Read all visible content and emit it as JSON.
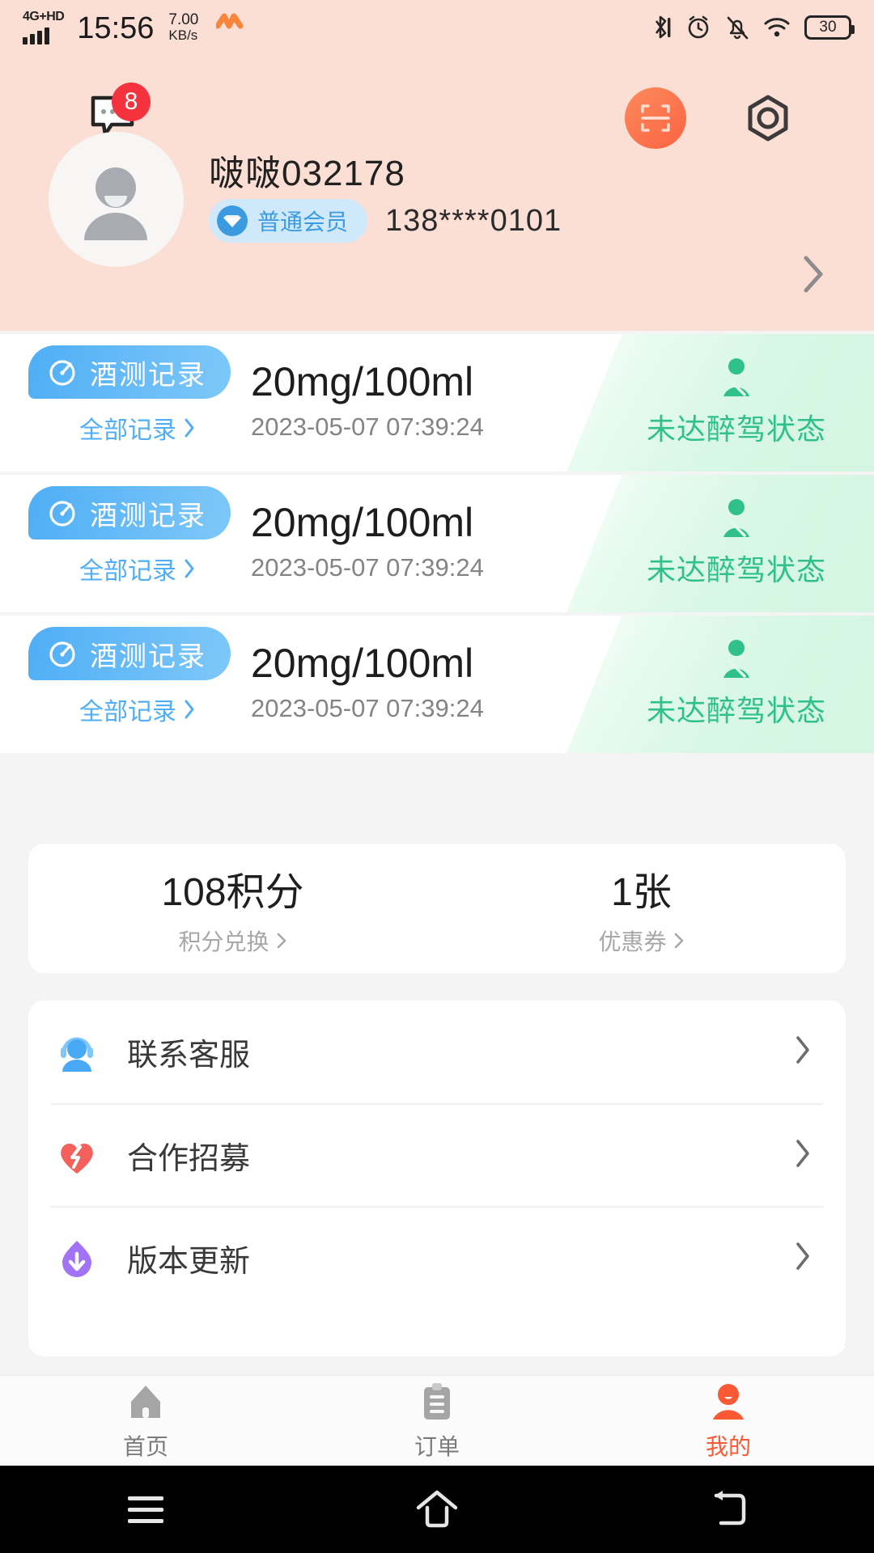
{
  "status_bar": {
    "network_type": "4G+HD",
    "time": "15:56",
    "net_speed_value": "7.00",
    "net_speed_unit": "KB/s",
    "heart_icon": "heart-icon",
    "bluetooth_icon": "bluetooth-icon",
    "alarm_icon": "alarm-clock-icon",
    "mute_icon": "bell-mute-icon",
    "wifi_icon": "wifi-icon",
    "battery_level": "30"
  },
  "header": {
    "message_icon": "message-icon",
    "message_badge": "8",
    "scan_icon": "scan-icon",
    "settings_icon": "settings-hex-icon",
    "avatar_icon": "avatar-placeholder-icon",
    "username": "啵啵032178",
    "vip_badge": "普通会员",
    "vip_icon": "diamond-icon",
    "phone": "138****0101",
    "arrow_icon": "chevron-right-icon",
    "bg_color": "#fbdfd5"
  },
  "records": [
    {
      "tag": "酒测记录",
      "tag_icon": "gauge-icon",
      "all_records": "全部记录",
      "value": "20mg/100ml",
      "time": "2023-05-07 07:39:24",
      "status": "未达醉驾状态",
      "status_icon": "seatbelt-driver-icon",
      "status_color": "#2fc08b"
    },
    {
      "tag": "酒测记录",
      "tag_icon": "gauge-icon",
      "all_records": "全部记录",
      "value": "20mg/100ml",
      "time": "2023-05-07 07:39:24",
      "status": "未达醉驾状态",
      "status_icon": "seatbelt-driver-icon",
      "status_color": "#2fc08b"
    },
    {
      "tag": "酒测记录",
      "tag_icon": "gauge-icon",
      "all_records": "全部记录",
      "value": "20mg/100ml",
      "time": "2023-05-07 07:39:24",
      "status": "未达醉驾状态",
      "status_icon": "seatbelt-driver-icon",
      "status_color": "#2fc08b"
    }
  ],
  "points_card": {
    "points_value": "108积分",
    "points_label": "积分兑换",
    "coupon_value": "1张",
    "coupon_label": "优惠券"
  },
  "menu": [
    {
      "label": "联系客服",
      "icon": "customer-service-icon",
      "icon_color": "#47a8f5"
    },
    {
      "label": "合作招募",
      "icon": "heart-handshake-icon",
      "icon_color": "#f4605c"
    },
    {
      "label": "版本更新",
      "icon": "download-update-icon",
      "icon_color": "#a274f5"
    }
  ],
  "tabbar": {
    "items": [
      {
        "label": "首页",
        "icon": "home-icon",
        "active": false
      },
      {
        "label": "订单",
        "icon": "clipboard-icon",
        "active": false
      },
      {
        "label": "我的",
        "icon": "person-icon",
        "active": true
      }
    ],
    "active_color": "#fa5a33",
    "inactive_color": "#a6a5a5"
  },
  "android_nav": {
    "menu_icon": "menu-icon",
    "home_icon": "home-outline-icon",
    "back_icon": "back-icon"
  }
}
